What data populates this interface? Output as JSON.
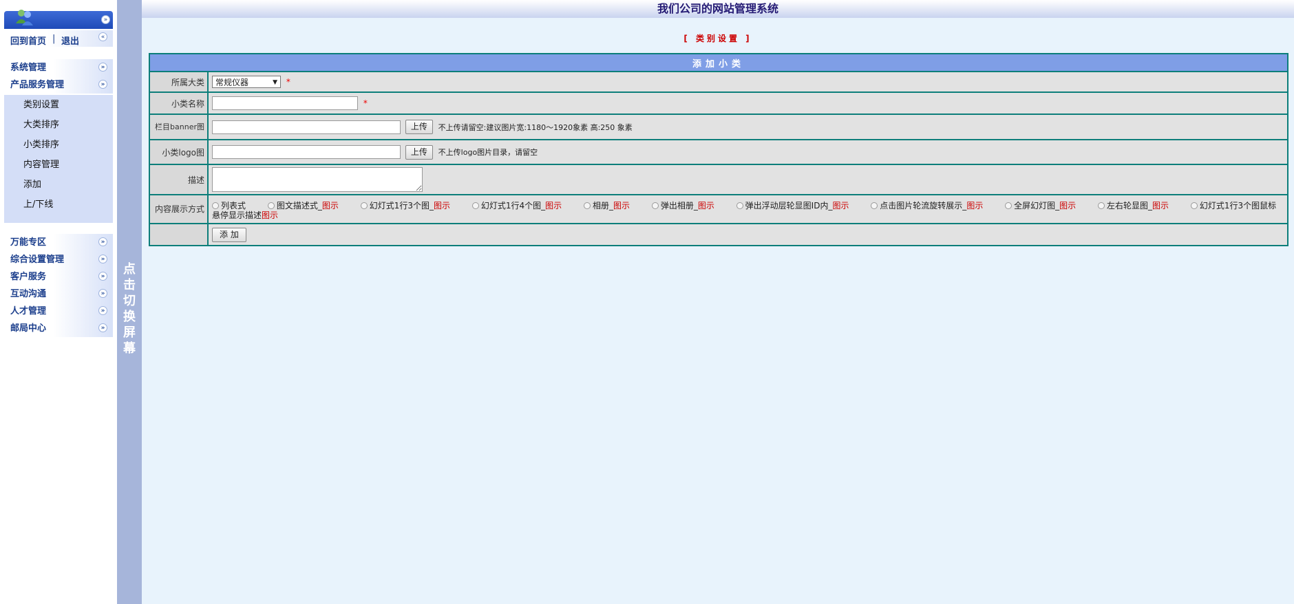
{
  "app": {
    "title": "我们公司的网站管理系统"
  },
  "sidebar": {
    "links": {
      "home": "回到首页",
      "sep": "|",
      "logout": "退出"
    },
    "group1": [
      {
        "label": "系统管理"
      },
      {
        "label": "产品服务管理"
      }
    ],
    "submenu": [
      {
        "label": "类别设置"
      },
      {
        "label": "大类排序"
      },
      {
        "label": "小类排序"
      },
      {
        "label": "内容管理"
      },
      {
        "label": "添加"
      },
      {
        "label": "上/下线"
      }
    ],
    "group2": [
      {
        "label": "万能专区"
      },
      {
        "label": "综合设置管理"
      },
      {
        "label": "客户服务"
      },
      {
        "label": "互动沟通"
      },
      {
        "label": "人才管理"
      },
      {
        "label": "邮局中心"
      }
    ]
  },
  "splitter": {
    "label": "点击切换屏幕"
  },
  "breadcrumb": "[ 类别设置 ]",
  "form": {
    "header": "添加小类",
    "parent_label": "所属大类",
    "parent_value": "常规仪器",
    "required_mark": "*",
    "name_label": "小类名称",
    "banner_label": "栏目banner图",
    "upload_label": "上传",
    "banner_hint": "不上传请留空:建议图片宽:1180～1920象素 高:250 象素",
    "logo_label": "小类logo图",
    "logo_hint": "不上传logo图片目录，请留空",
    "desc_label": "描述",
    "display_label": "内容展示方式",
    "display_options": [
      {
        "text": "列表式",
        "link": ""
      },
      {
        "text": "图文描述式_",
        "link": "图示"
      },
      {
        "text": "幻灯式1行3个图_",
        "link": "图示"
      },
      {
        "text": "幻灯式1行4个图_",
        "link": "图示"
      },
      {
        "text": "相册_",
        "link": "图示"
      },
      {
        "text": "弹出相册_",
        "link": "图示"
      },
      {
        "text": "弹出浮动层轮显图ID内_",
        "link": "图示"
      },
      {
        "text": "点击图片轮流旋转展示_",
        "link": "图示"
      },
      {
        "text": "全屏幻灯图_",
        "link": "图示"
      },
      {
        "text": "左右轮显图_",
        "link": "图示"
      }
    ],
    "last_option_text": "幻灯式1行3个图鼠标悬停显示描述",
    "last_option_link": "图示",
    "submit_label": "添 加"
  }
}
